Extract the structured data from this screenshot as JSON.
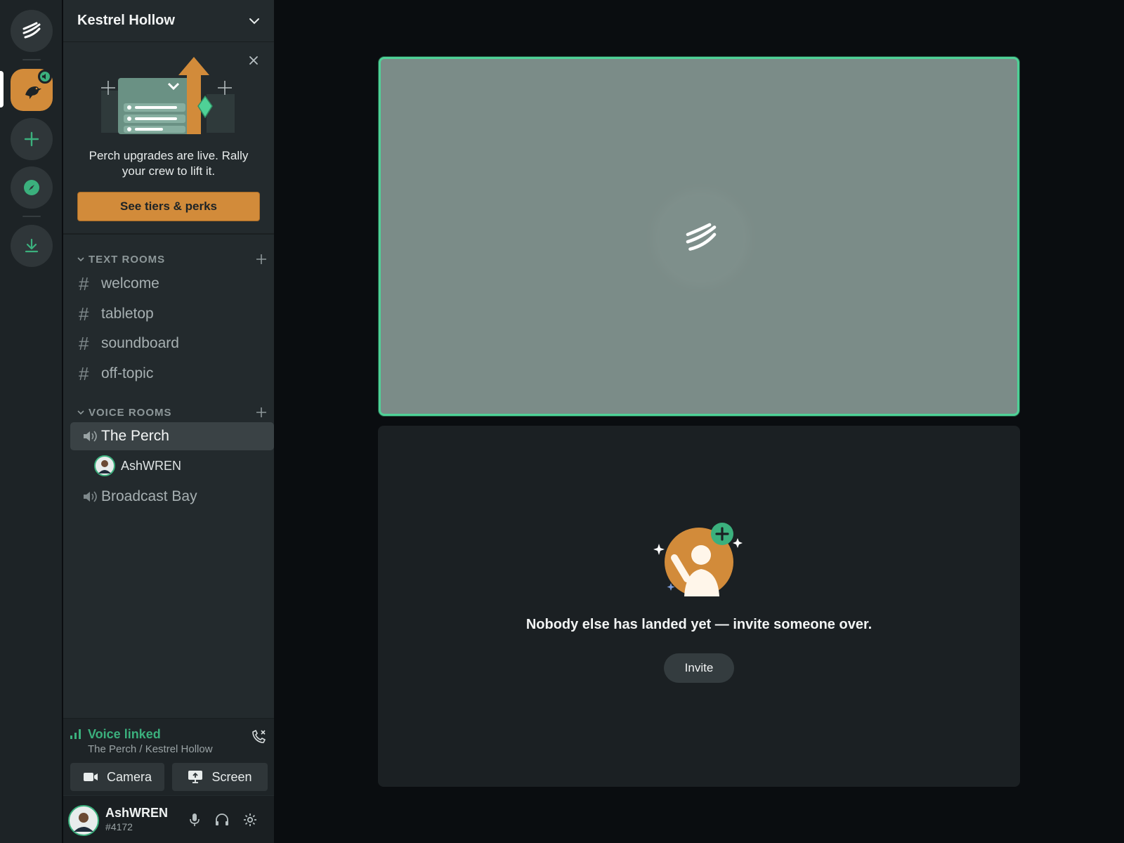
{
  "server": {
    "name": "Kestrel Hollow"
  },
  "promo": {
    "text": "Perch upgrades are live. Rally your crew to lift it.",
    "button": "See tiers & perks"
  },
  "categories": {
    "text": "TEXT ROOMS",
    "voice": "VOICE ROOMS"
  },
  "text_channels": [
    "welcome",
    "tabletop",
    "soundboard",
    "off-topic"
  ],
  "voice_channels": [
    {
      "name": "The Perch",
      "active": true,
      "users": [
        "AshWREN"
      ]
    },
    {
      "name": "Broadcast Bay",
      "active": false,
      "users": []
    }
  ],
  "voice_panel": {
    "status": "Voice linked",
    "location": "The Perch / Kestrel Hollow",
    "camera_label": "Camera",
    "screen_label": "Screen"
  },
  "user": {
    "name": "AshWREN",
    "tag": "#4172"
  },
  "main": {
    "empty_message": "Nobody else has landed yet — invite someone over.",
    "invite_label": "Invite"
  },
  "colors": {
    "accent_green": "#3bb07d",
    "brand_orange": "#d28b3a",
    "speaking_border": "#4fd197"
  }
}
